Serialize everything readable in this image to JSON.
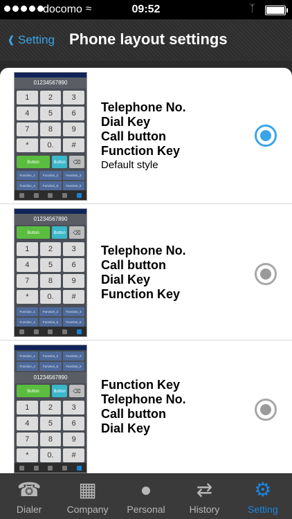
{
  "statusbar": {
    "carrier": "docomo",
    "time": "09:52"
  },
  "navbar": {
    "back_label": "Setting",
    "title": "Phone layout settings"
  },
  "thumb": {
    "number": "01234567890",
    "keys": [
      "1",
      "2",
      "3",
      "4",
      "5",
      "6",
      "7",
      "8",
      "9",
      "*",
      "0.",
      "#"
    ],
    "button": "Button",
    "del": "⌫",
    "functions": [
      "Function_1",
      "Function_2",
      "Function_3",
      "Function_4",
      "Function_5",
      "Function_6"
    ]
  },
  "options": [
    {
      "lines": [
        "Telephone No.",
        "Dial Key",
        "Call button",
        "Function Key"
      ],
      "sub": "Default style",
      "selected": true
    },
    {
      "lines": [
        "Telephone No.",
        "Call button",
        "Dial Key",
        "Function Key"
      ],
      "sub": "",
      "selected": false
    },
    {
      "lines": [
        "Function Key",
        "Telephone No.",
        "Call button",
        "Dial Key"
      ],
      "sub": "",
      "selected": false
    }
  ],
  "tabs": [
    {
      "label": "Dialer",
      "icon": "dialpad-phone-icon"
    },
    {
      "label": "Company",
      "icon": "building-icon"
    },
    {
      "label": "Personal",
      "icon": "person-icon"
    },
    {
      "label": "History",
      "icon": "history-arrows-icon"
    },
    {
      "label": "Setting",
      "icon": "gears-icon",
      "active": true
    }
  ],
  "colors": {
    "accent": "#3aa6e8",
    "call_green": "#5bbd3f",
    "button_teal": "#3ab7c9",
    "function_blue": "#4e6a9a"
  }
}
